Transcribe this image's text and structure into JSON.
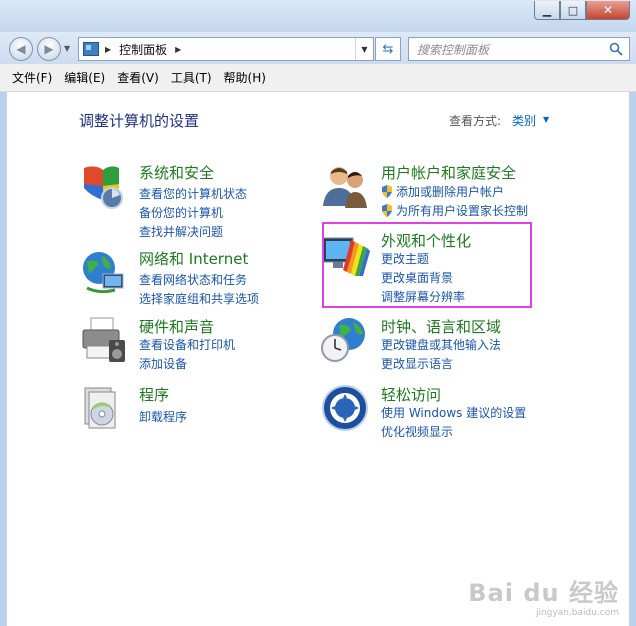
{
  "window": {
    "caption_buttons": {
      "minimize": "▁",
      "maximize": "□",
      "close": "✕"
    }
  },
  "navbar": {
    "back_icon": "back-arrow-icon",
    "forward_icon": "forward-arrow-icon",
    "address": {
      "path": "控制面板"
    },
    "search": {
      "placeholder": "搜索控制面板"
    }
  },
  "menubar": {
    "items": [
      "文件(F)",
      "编辑(E)",
      "查看(V)",
      "工具(T)",
      "帮助(H)"
    ]
  },
  "main": {
    "title": "调整计算机的设置",
    "view_by_label": "查看方式:",
    "view_by_value": "类别",
    "categories": [
      {
        "title": "系统和安全",
        "icon": "shield-system-icon",
        "links": [
          "查看您的计算机状态",
          "备份您的计算机",
          "查找并解决问题"
        ]
      },
      {
        "title": "网络和 Internet",
        "icon": "network-globe-icon",
        "links": [
          "查看网络状态和任务",
          "选择家庭组和共享选项"
        ]
      },
      {
        "title": "硬件和声音",
        "icon": "printer-icon",
        "links": [
          "查看设备和打印机",
          "添加设备"
        ]
      },
      {
        "title": "程序",
        "icon": "programs-icon",
        "links": [
          "卸载程序"
        ]
      },
      {
        "title": "用户帐户和家庭安全",
        "icon": "users-icon",
        "links": [
          "添加或删除用户帐户",
          "为所有用户设置家长控制"
        ]
      },
      {
        "title": "外观和个性化",
        "icon": "monitor-palette-icon",
        "links": [
          "更改主题",
          "更改桌面背景",
          "调整屏幕分辨率"
        ]
      },
      {
        "title": "时钟、语言和区域",
        "icon": "clock-globe-icon",
        "links": [
          "更改键盘或其他输入法",
          "更改显示语言"
        ]
      },
      {
        "title": "轻松访问",
        "icon": "ease-of-access-icon",
        "links": [
          "使用 Windows 建议的设置",
          "优化视频显示"
        ]
      }
    ],
    "highlight_color": "#e040e8"
  },
  "watermark": {
    "brand": "Bai du 经验",
    "url": "jingyan.baidu.com"
  }
}
